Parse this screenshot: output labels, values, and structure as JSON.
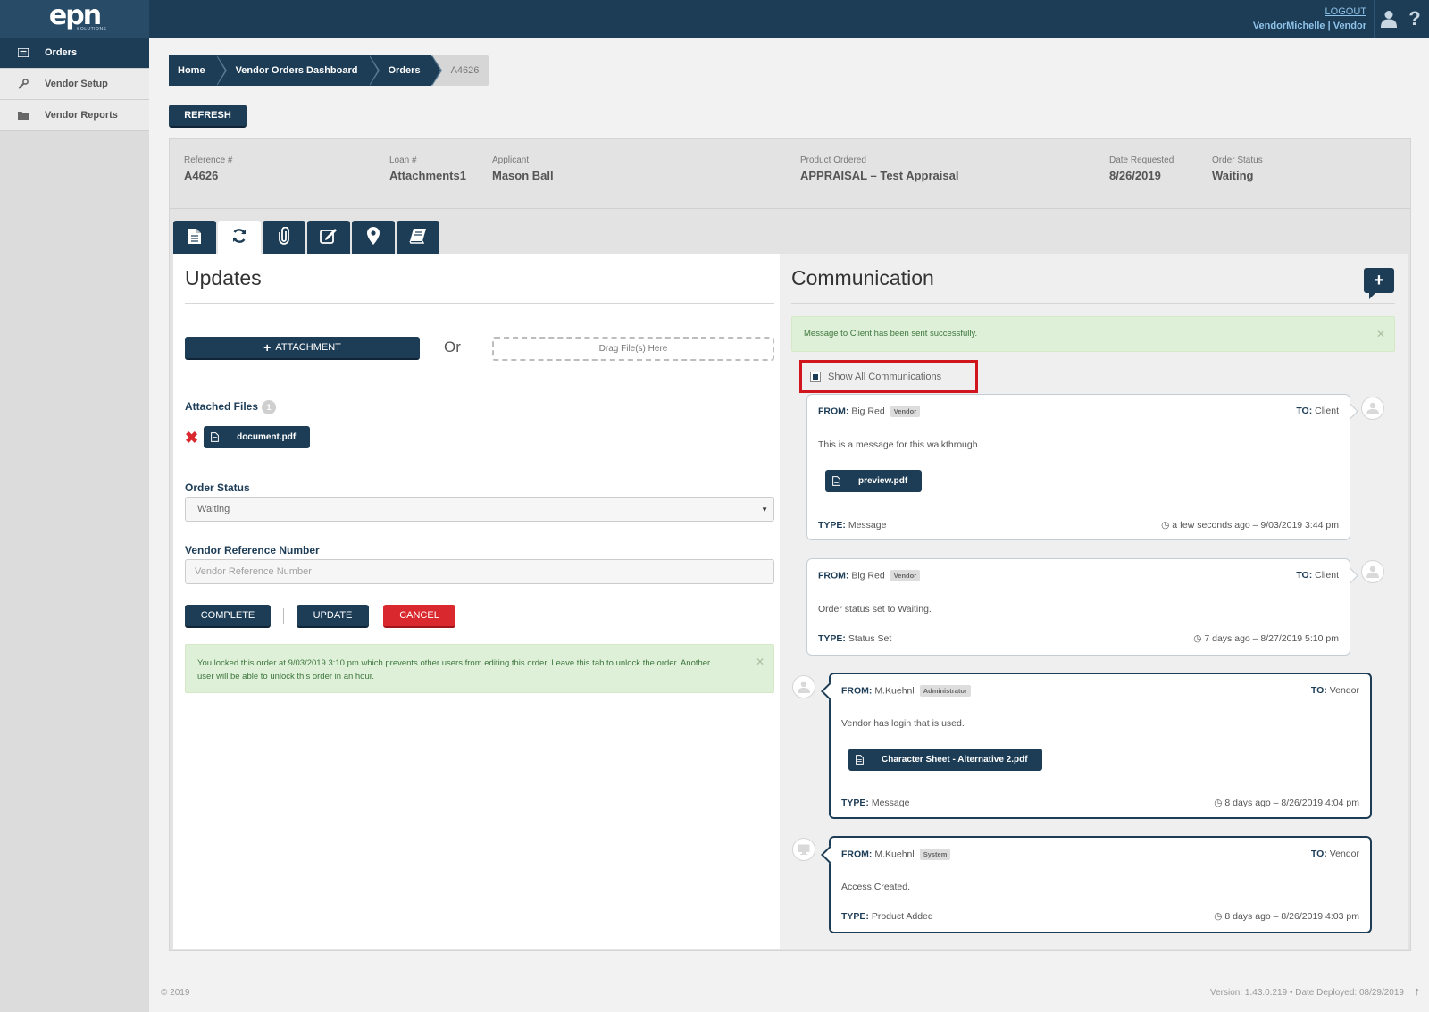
{
  "header": {
    "logo_text": "epn",
    "logo_sub": "SOLUTIONS",
    "logout_label": "LOGOUT",
    "user_label": "VendorMichelle | Vendor",
    "help_label": "?"
  },
  "sidebar": {
    "items": [
      {
        "label": "Orders",
        "icon": "list-icon"
      },
      {
        "label": "Vendor Setup",
        "icon": "wrench-icon"
      },
      {
        "label": "Vendor Reports",
        "icon": "folder-icon"
      }
    ]
  },
  "breadcrumb": [
    "Home",
    "Vendor Orders Dashboard",
    "Orders",
    "A4626"
  ],
  "refresh_label": "REFRESH",
  "order": {
    "fields": [
      {
        "label": "Reference #",
        "value": "A4626"
      },
      {
        "label": "Loan #",
        "value": "Attachments1"
      },
      {
        "label": "Applicant",
        "value": "Mason Ball"
      },
      {
        "label": "Product Ordered",
        "value": "APPRAISAL – Test Appraisal"
      },
      {
        "label": "Date Requested",
        "value": "8/26/2019"
      },
      {
        "label": "Order Status",
        "value": "Waiting"
      }
    ]
  },
  "tabs": [
    "document-icon",
    "refresh-icon",
    "paperclip-icon",
    "edit-icon",
    "map-marker-icon",
    "book-icon"
  ],
  "updates": {
    "title": "Updates",
    "attachment_label": "ATTACHMENT",
    "or_label": "Or",
    "drop_label": "Drag File(s) Here",
    "attached_files_label": "Attached Files",
    "attached_count": "1",
    "file_name": "document.pdf",
    "order_status_label": "Order Status",
    "order_status_value": "Waiting",
    "vendor_ref_label": "Vendor Reference Number",
    "vendor_ref_placeholder": "Vendor Reference Number",
    "complete_label": "COMPLETE",
    "update_label": "UPDATE",
    "cancel_label": "CANCEL",
    "lock_notice": "You locked this order at 9/03/2019 3:10 pm which prevents other users from editing this order. Leave this tab to unlock the order. Another user will be able to unlock this order in an hour."
  },
  "communication": {
    "title": "Communication",
    "success_message": "Message to Client has been sent successfully.",
    "show_all_label": "Show All Communications",
    "messages": [
      {
        "from_label": "FROM:",
        "from": "Big Red",
        "role": "Vendor",
        "to_label": "TO:",
        "to": "Client",
        "body": "This is a message for this walkthrough.",
        "attachment": "preview.pdf",
        "type_label": "TYPE:",
        "type": "Message",
        "time": "a few seconds ago – 9/03/2019 3:44 pm"
      },
      {
        "from_label": "FROM:",
        "from": "Big Red",
        "role": "Vendor",
        "to_label": "TO:",
        "to": "Client",
        "body": "Order status set to Waiting.",
        "type_label": "TYPE:",
        "type": "Status Set",
        "time": "7 days ago – 8/27/2019 5:10 pm"
      },
      {
        "from_label": "FROM:",
        "from": "M.Kuehnl",
        "role": "Administrator",
        "to_label": "TO:",
        "to": "Vendor",
        "body": "Vendor has login that is used.",
        "attachment": "Character Sheet - Alternative 2.pdf",
        "type_label": "TYPE:",
        "type": "Message",
        "time": "8 days ago – 8/26/2019 4:04 pm"
      },
      {
        "from_label": "FROM:",
        "from": "M.Kuehnl",
        "role": "System",
        "to_label": "TO:",
        "to": "Vendor",
        "body": "Access Created.",
        "type_label": "TYPE:",
        "type": "Product Added",
        "time": "8 days ago – 8/26/2019 4:03 pm"
      }
    ]
  },
  "footer": {
    "copyright": "© 2019",
    "version": "Version: 1.43.0.219  •  Date Deployed: 08/29/2019"
  }
}
